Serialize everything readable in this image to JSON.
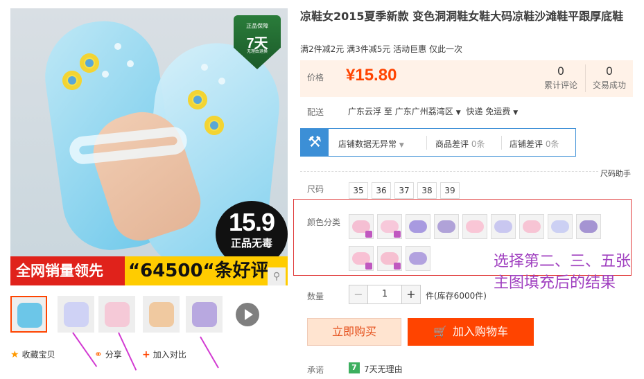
{
  "main_image": {
    "badge_top": "正品保障",
    "badge_number": "7天",
    "badge_sub": "无理由退换",
    "price_badge_price": "15.9",
    "price_badge_text": "正品无毒",
    "sales_band_left": "全网销量领先",
    "sales_band_right": "“64500“条好评",
    "zoom_icon": "search-icon"
  },
  "thumbnails": [
    {
      "color": "#6cc6e8"
    },
    {
      "color": "#cfd2f5"
    },
    {
      "color": "#f5c9d7"
    },
    {
      "color": "#f0c9a0"
    },
    {
      "color": "#b8a8e0"
    }
  ],
  "actions": {
    "favorite": "收藏宝贝",
    "share": "分享",
    "compare": "加入对比"
  },
  "product": {
    "title": "凉鞋女2015夏季新款 变色洞洞鞋女鞋大码凉鞋沙滩鞋平跟厚底鞋",
    "promo": "满2件减2元 满3件减5元 活动巨惠 仅此一次"
  },
  "price": {
    "label": "价格",
    "currency": "¥",
    "value": "15.80",
    "reviews_count": "0",
    "reviews_label": "累计评论",
    "sales_count": "0",
    "sales_label": "交易成功"
  },
  "shipping": {
    "label": "配送",
    "from": "广东云浮",
    "to_word": "至",
    "to": "广东广州荔湾区",
    "method": "快递 免运费"
  },
  "shop": {
    "data_status": "店铺数据无异常",
    "product_bad_label": "商品差评",
    "product_bad_value": "0条",
    "shop_bad_label": "店铺差评",
    "shop_bad_value": "0条"
  },
  "size": {
    "helper": "尺码助手",
    "label": "尺码",
    "options": [
      "35",
      "36",
      "37",
      "38",
      "39"
    ]
  },
  "colors": {
    "label": "颜色分类",
    "swatches": [
      "#f5bfd3",
      "#f7c8da",
      "#a89ae0",
      "#b0a2d8",
      "#f9c6d6",
      "#c9c7f0",
      "#f7c4d4",
      "#ccd0f3",
      "#a594d2",
      "#f8c1d4",
      "#f6c0d1",
      "#b2a2df"
    ]
  },
  "annotation": "选择第二、三、五张主图填充后的结果",
  "quantity": {
    "label": "数量",
    "minus": "−",
    "value": "1",
    "plus": "+",
    "stock": "件(库存6000件)"
  },
  "buttons": {
    "buy_now": "立即购买",
    "add_to_cart": "加入购物车"
  },
  "promise": {
    "label": "承诺",
    "icon_text": "7",
    "text": "7天无理由"
  }
}
